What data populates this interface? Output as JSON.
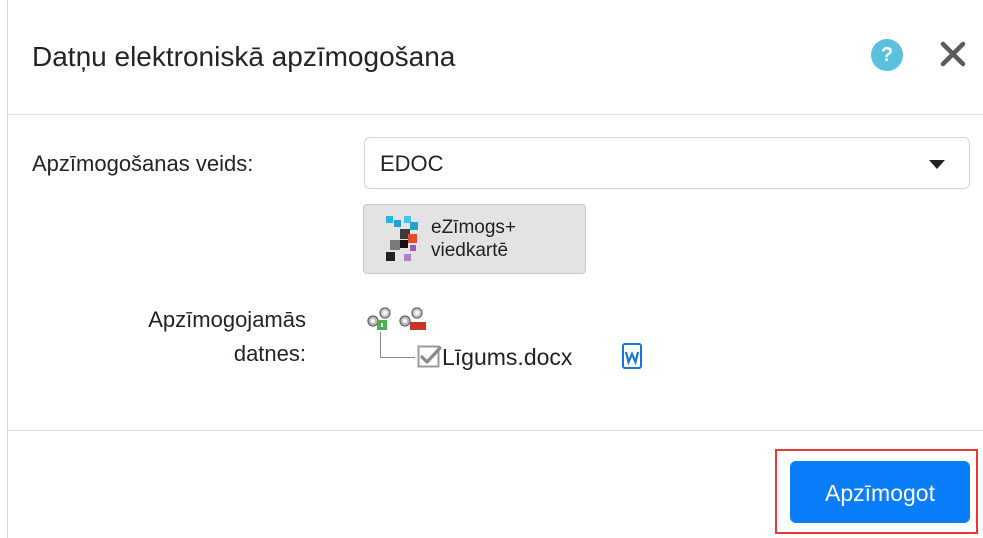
{
  "dialog": {
    "title": "Datņu elektroniskā apzīmogošana",
    "help_icon_text": "?",
    "help_icon": "question-circle-icon",
    "close_icon": "close-x-icon"
  },
  "form": {
    "type_label": "Apzīmogošanas veids:",
    "type_value": "EDOC",
    "seal_option": {
      "line1": "eZīmogs+",
      "line2": "viedkartē",
      "icon": "ezimogs-logo-icon"
    },
    "files_label_line1": "Apzīmogojamās",
    "files_label_line2": "datnes:",
    "files": [
      {
        "name": "Līgums.docx",
        "checked": true,
        "icon": "word-document-icon"
      }
    ]
  },
  "footer": {
    "submit_label": "Apzīmogot"
  },
  "colors": {
    "primary": "#0a7dfb",
    "help": "#5bc0de",
    "highlight_frame": "#e53935"
  }
}
